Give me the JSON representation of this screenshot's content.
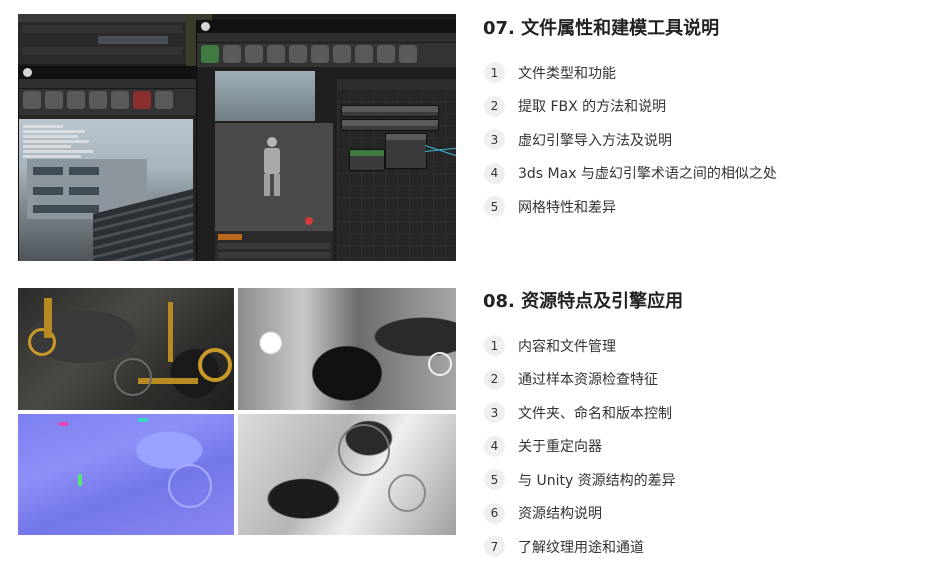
{
  "sections": [
    {
      "title": "07. 文件属性和建模工具说明",
      "items": [
        {
          "num": "1",
          "label": "文件类型和功能"
        },
        {
          "num": "2",
          "label": "提取 FBX 的方法和说明"
        },
        {
          "num": "3",
          "label": "虚幻引擎导入方法及说明"
        },
        {
          "num": "4",
          "label": "3ds Max 与虚幻引擎术语之间的相似之处"
        },
        {
          "num": "5",
          "label": "网格特性和差异"
        }
      ]
    },
    {
      "title": "08. 资源特点及引擎应用",
      "items": [
        {
          "num": "1",
          "label": "内容和文件管理"
        },
        {
          "num": "2",
          "label": "通过样本资源检查特征"
        },
        {
          "num": "3",
          "label": "文件夹、命名和版本控制"
        },
        {
          "num": "4",
          "label": "关于重定向器"
        },
        {
          "num": "5",
          "label": "与 Unity 资源结构的差异"
        },
        {
          "num": "6",
          "label": "资源结构说明"
        },
        {
          "num": "7",
          "label": "了解纹理用途和通道"
        }
      ]
    }
  ],
  "images": [
    {
      "name": "unreal-editor-screenshot"
    },
    {
      "name": "texture-maps-screenshot"
    }
  ]
}
